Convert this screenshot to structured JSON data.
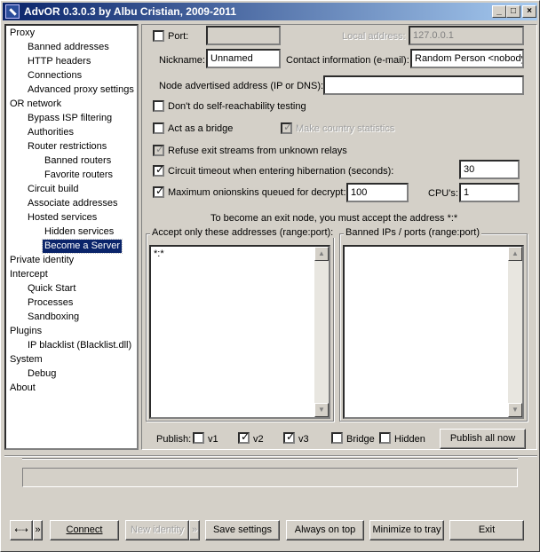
{
  "window": {
    "title": "AdvOR  0.3.0.3 by Albu Cristian, 2009-2011"
  },
  "titlebar_buttons": {
    "minimize": "_",
    "maximize": "□",
    "close": "×"
  },
  "tree": [
    {
      "label": "Proxy",
      "level": 0
    },
    {
      "label": "Banned addresses",
      "level": 1
    },
    {
      "label": "HTTP headers",
      "level": 1
    },
    {
      "label": "Connections",
      "level": 1
    },
    {
      "label": "Advanced proxy settings",
      "level": 1
    },
    {
      "label": "OR network",
      "level": 0
    },
    {
      "label": "Bypass ISP filtering",
      "level": 1
    },
    {
      "label": "Authorities",
      "level": 1
    },
    {
      "label": "Router restrictions",
      "level": 1
    },
    {
      "label": "Banned routers",
      "level": 2
    },
    {
      "label": "Favorite routers",
      "level": 2
    },
    {
      "label": "Circuit build",
      "level": 1
    },
    {
      "label": "Associate addresses",
      "level": 1
    },
    {
      "label": "Hosted services",
      "level": 1
    },
    {
      "label": "Hidden services",
      "level": 2
    },
    {
      "label": "Become a Server",
      "level": 2,
      "selected": true
    },
    {
      "label": "Private identity",
      "level": 0
    },
    {
      "label": "Intercept",
      "level": 0
    },
    {
      "label": "Quick Start",
      "level": 1
    },
    {
      "label": "Processes",
      "level": 1
    },
    {
      "label": "Sandboxing",
      "level": 1
    },
    {
      "label": "Plugins",
      "level": 0
    },
    {
      "label": "IP blacklist (Blacklist.dll)",
      "level": 1
    },
    {
      "label": "System",
      "level": 0
    },
    {
      "label": "Debug",
      "level": 1
    },
    {
      "label": "About",
      "level": 0
    }
  ],
  "server": {
    "port_label": "Port:",
    "port_value": "",
    "local_address_label": "Local address:",
    "local_address_value": "127.0.0.1",
    "nickname_label": "Nickname:",
    "nickname_value": "Unnamed",
    "contact_label": "Contact information (e-mail):",
    "contact_value": "Random Person <nobody",
    "advertised_label": "Node advertised address (IP or DNS):",
    "advertised_value": "",
    "no_reachability_label": "Don't do self-reachability testing",
    "bridge_label": "Act as a bridge",
    "country_stats_label": "Make country statistics",
    "refuse_exit_label": "Refuse exit streams from unknown relays",
    "circuit_timeout_label": "Circuit timeout when entering hibernation (seconds):",
    "circuit_timeout_value": "30",
    "max_onionskins_label": "Maximum onionskins queued for decrypt:",
    "max_onionskins_value": "100",
    "cpus_label": "CPU's:",
    "cpus_value": "1",
    "exit_note": "To become an exit node, you must accept the address *:*",
    "accept_title": "Accept only these addresses (range:port):",
    "accept_text": "*:*",
    "banned_title": "Banned IPs / ports (range:port)",
    "banned_text": "",
    "publish_label": "Publish:",
    "v1_label": "v1",
    "v2_label": "v2",
    "v3_label": "v3",
    "bridge_pub_label": "Bridge",
    "hidden_label": "Hidden",
    "publish_now_label": "Publish all now"
  },
  "checkbox_mark": "✓",
  "bottom": {
    "menu_glyph": "⇠⇢",
    "arrow_glyph": "»",
    "connect_label": "Connect",
    "new_identity_label": "New identity",
    "save_settings_label": "Save settings",
    "always_on_top_label": "Always on top",
    "minimize_tray_label": "Minimize to tray",
    "exit_label": "Exit"
  },
  "scroll_glyphs": {
    "up": "▲",
    "down": "▼"
  }
}
